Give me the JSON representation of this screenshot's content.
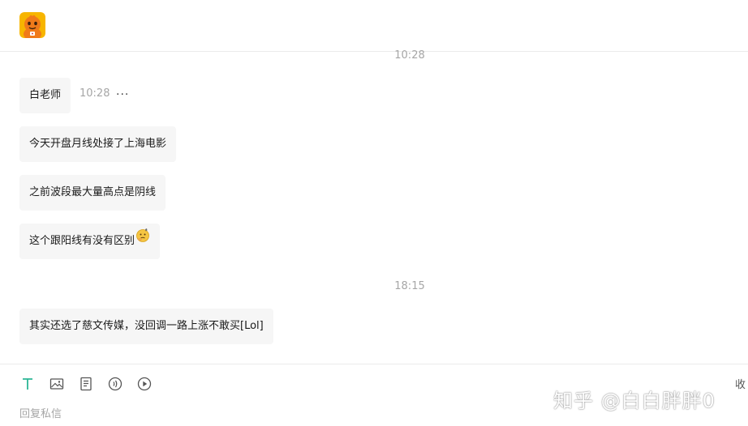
{
  "header": {
    "avatar_icon": "mascot-avatar-icon"
  },
  "conversation": {
    "dividers": [
      "10:28",
      "18:15"
    ],
    "messages": [
      {
        "text": "白老师",
        "time": "10:28"
      },
      {
        "text": "今天开盘月线处接了上海电影"
      },
      {
        "text": "之前波段最大量高点是阴线"
      },
      {
        "text": "这个跟阳线有没有区别",
        "emoji": "thinking-emoji-icon"
      },
      {
        "text": "其实还选了慈文传媒，没回调一路上涨不敢买[Lol]"
      }
    ],
    "more_label": "···"
  },
  "composer": {
    "tools": [
      "text-format-icon",
      "image-icon",
      "document-icon",
      "audio-icon",
      "video-play-icon"
    ],
    "placeholder": "回复私信",
    "collapse_label": "收",
    "accent": "#2cb696"
  },
  "watermark": "知乎 @白白胖胖0",
  "colors": {
    "bubble_bg": "#f6f6f6",
    "muted_text": "#a6a6a6",
    "divider": "#ebebeb"
  }
}
